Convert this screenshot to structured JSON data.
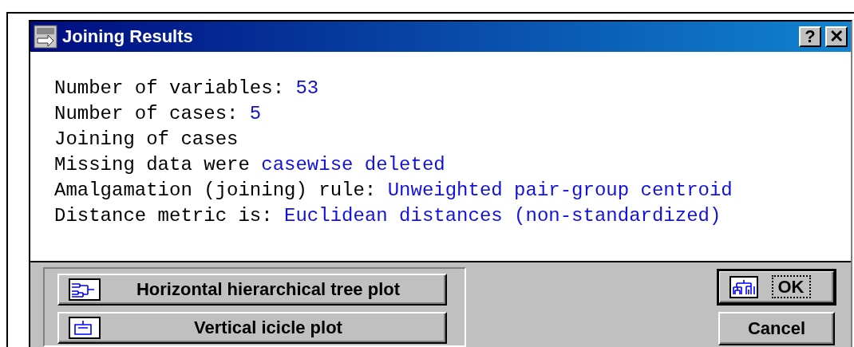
{
  "window": {
    "title": "Joining Results"
  },
  "title_buttons": [
    {
      "kind": "help",
      "label": "?"
    },
    {
      "kind": "close",
      "label": "✕"
    }
  ],
  "results": [
    {
      "label": "Number of variables:",
      "value": "53"
    },
    {
      "label": "Number of cases:",
      "value": "5"
    },
    {
      "label": "Joining of cases"
    },
    {
      "label": "Missing data were",
      "value": "casewise deleted"
    },
    {
      "label": "Amalgamation (joining) rule:",
      "value": "Unweighted pair-group centroid"
    },
    {
      "label": "Distance metric is:",
      "value": "Euclidean distances (non-standardized)"
    }
  ],
  "plot_buttons": [
    {
      "kind": "horizontal-tree",
      "label": "Horizontal hierarchical tree plot"
    },
    {
      "kind": "vertical-icicle",
      "label": "Vertical icicle plot"
    }
  ],
  "dialog_buttons": [
    {
      "kind": "ok",
      "label": "OK",
      "default": true
    },
    {
      "kind": "cancel",
      "label": "Cancel",
      "default": false
    }
  ]
}
